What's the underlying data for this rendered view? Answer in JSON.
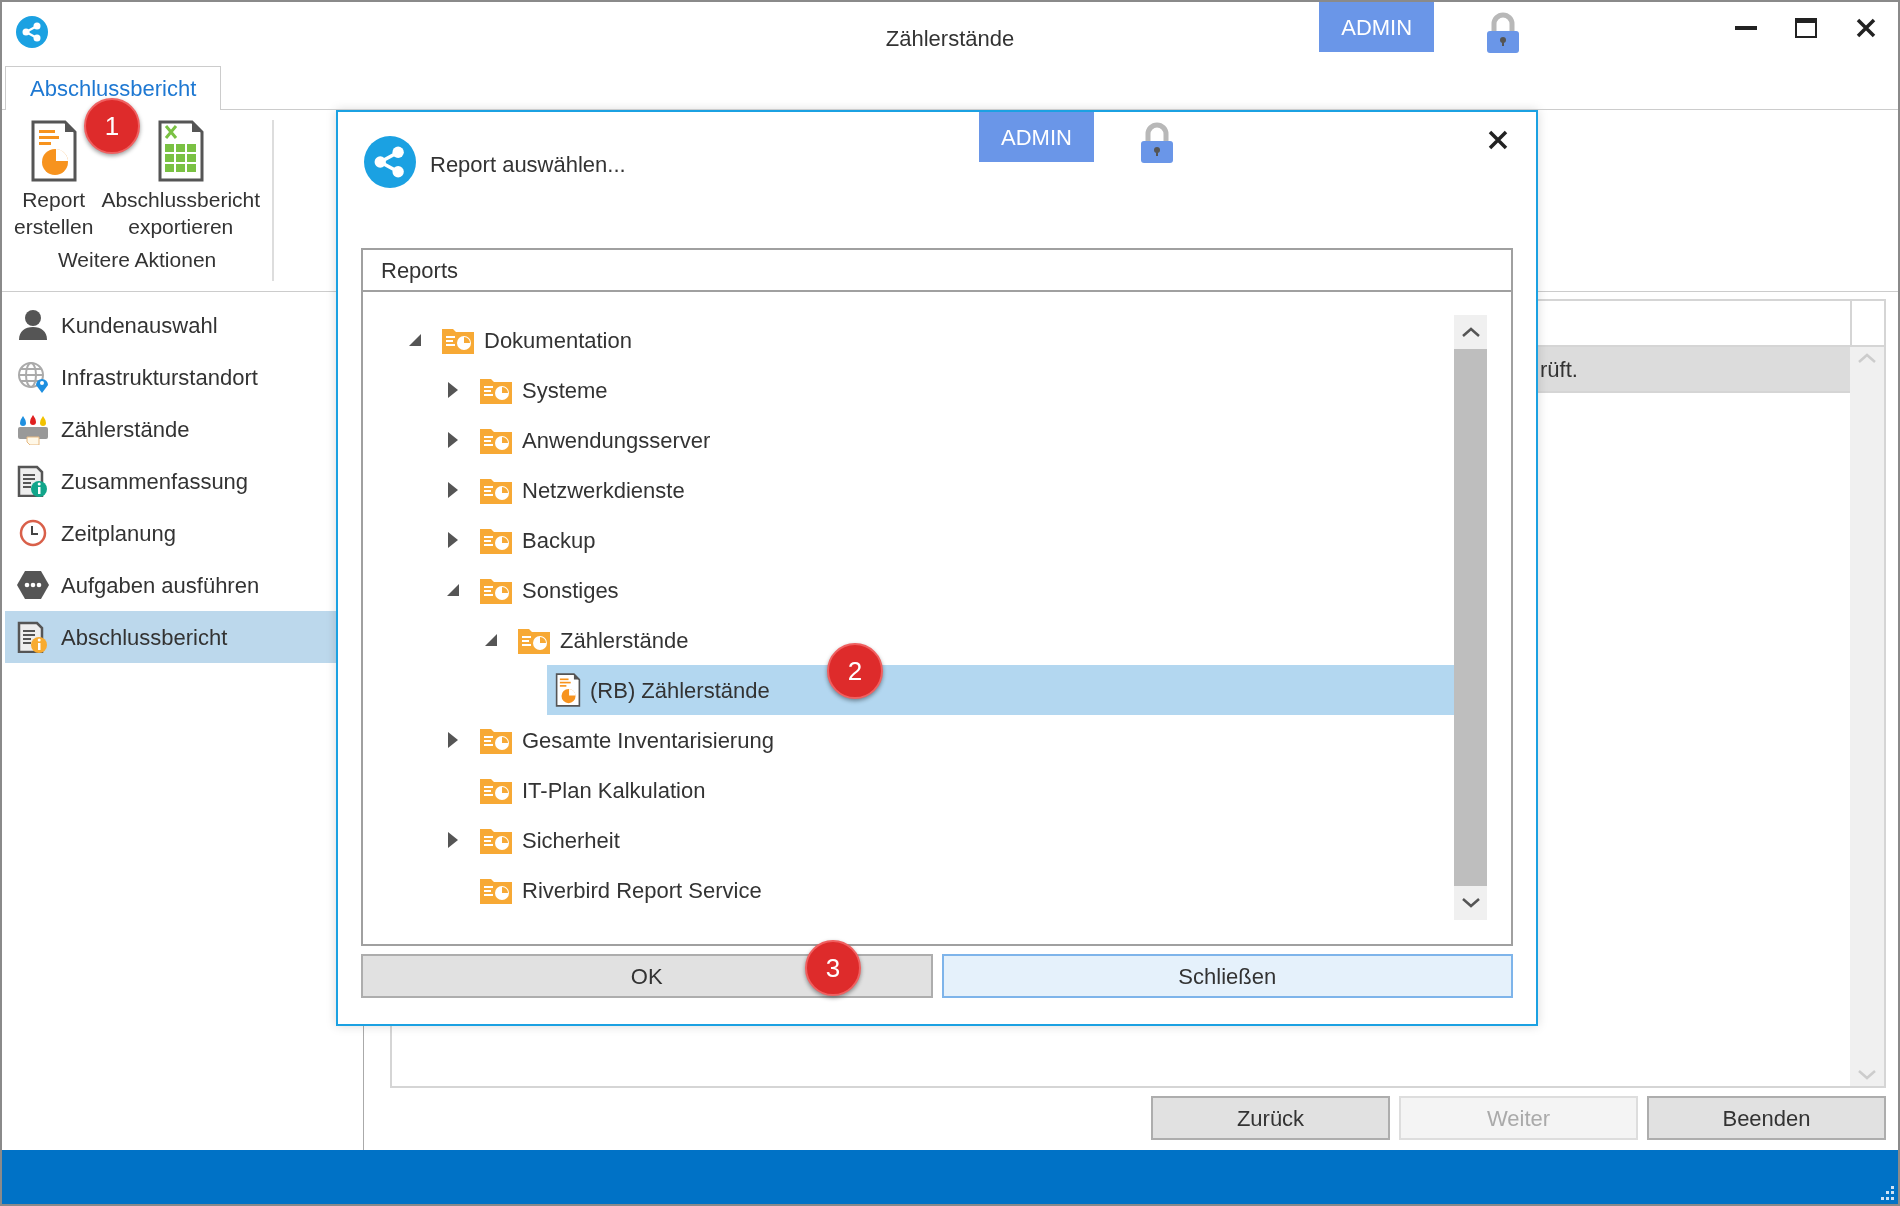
{
  "window": {
    "title": "Zählerstände",
    "user_badge": "ADMIN"
  },
  "ribbon": {
    "tabs": [
      {
        "label": "Abschlussbericht",
        "selected": true,
        "callout": "1"
      }
    ],
    "buttons": [
      {
        "label": "Report erstellen",
        "kind": "report"
      },
      {
        "label": "Abschlussbericht exportieren",
        "kind": "spreadsheet"
      }
    ],
    "group_label": "Weitere Aktionen"
  },
  "sidebar": {
    "items": [
      {
        "label": "Kundenauswahl",
        "kind": "person",
        "selected": false
      },
      {
        "label": "Infrastrukturstandort",
        "kind": "globe",
        "selected": false
      },
      {
        "label": "Zählerstände",
        "kind": "printer",
        "selected": false
      },
      {
        "label": "Zusammenfassung",
        "kind": "info-teal",
        "selected": false
      },
      {
        "label": "Zeitplanung",
        "kind": "clock",
        "selected": false
      },
      {
        "label": "Aufgaben ausführen",
        "kind": "hexagon",
        "selected": false
      },
      {
        "label": "Abschlussbericht",
        "kind": "info-orange",
        "selected": true
      }
    ]
  },
  "main": {
    "table": {
      "rows": [
        {
          "text": "rüft.",
          "selected": true
        }
      ]
    },
    "buttons": [
      {
        "label": "Zurück",
        "disabled": false
      },
      {
        "label": "Weiter",
        "disabled": true
      },
      {
        "label": "Beenden",
        "disabled": false
      }
    ]
  },
  "dialog": {
    "title": "Report auswählen...",
    "user_badge": "ADMIN",
    "group_title": "Reports",
    "tree": [
      {
        "label": "Dokumentation",
        "kind": "folder",
        "expanded": true,
        "selected": false,
        "children": [
          {
            "label": "Systeme",
            "kind": "folder",
            "expanded": false,
            "selected": false
          },
          {
            "label": "Anwendungsserver",
            "kind": "folder",
            "expanded": false,
            "selected": false
          },
          {
            "label": "Netzwerkdienste",
            "kind": "folder",
            "expanded": false,
            "selected": false
          },
          {
            "label": "Backup",
            "kind": "folder",
            "expanded": false,
            "selected": false
          },
          {
            "label": "Sonstiges",
            "kind": "folder",
            "expanded": true,
            "selected": false,
            "children": [
              {
                "label": "Zählerstände",
                "kind": "folder",
                "expanded": true,
                "selected": false,
                "children": [
                  {
                    "label": "(RB) Zählerstände",
                    "kind": "report",
                    "selected": true,
                    "callout": "2"
                  }
                ]
              }
            ]
          },
          {
            "label": "Gesamte Inventarisierung",
            "kind": "folder",
            "expanded": false,
            "selected": false
          },
          {
            "label": "IT-Plan Kalkulation",
            "kind": "folder",
            "selected": false
          },
          {
            "label": "Sicherheit",
            "kind": "folder",
            "expanded": false,
            "selected": false
          },
          {
            "label": "Riverbird Report Service",
            "kind": "folder",
            "selected": false
          }
        ]
      }
    ],
    "buttons": [
      {
        "label": "OK",
        "kind": "default",
        "callout": "3"
      },
      {
        "label": "Schließen",
        "kind": "focused"
      }
    ]
  }
}
